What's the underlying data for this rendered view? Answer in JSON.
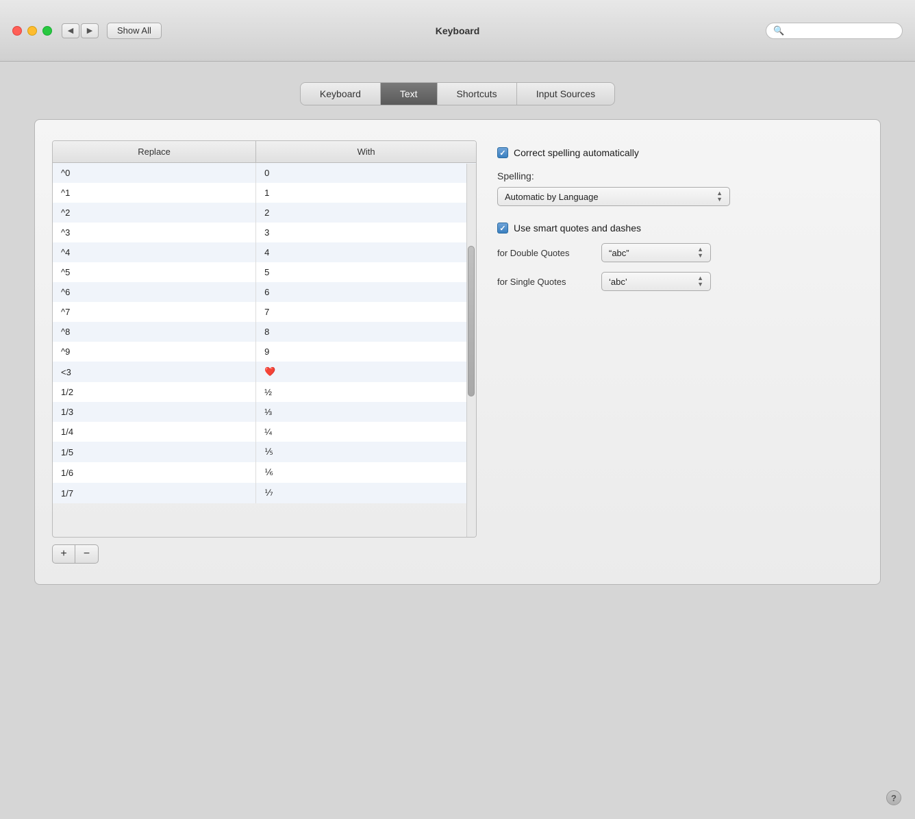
{
  "window": {
    "title": "Keyboard"
  },
  "titlebar": {
    "show_all_label": "Show All",
    "search_placeholder": ""
  },
  "tabs": [
    {
      "id": "keyboard",
      "label": "Keyboard",
      "active": false
    },
    {
      "id": "text",
      "label": "Text",
      "active": true
    },
    {
      "id": "shortcuts",
      "label": "Shortcuts",
      "active": false
    },
    {
      "id": "input-sources",
      "label": "Input Sources",
      "active": false
    }
  ],
  "table": {
    "col_replace": "Replace",
    "col_with": "With",
    "rows": [
      {
        "replace": "^0",
        "with": "0"
      },
      {
        "replace": "^1",
        "with": "1"
      },
      {
        "replace": "^2",
        "with": "2"
      },
      {
        "replace": "^3",
        "with": "3"
      },
      {
        "replace": "^4",
        "with": "4"
      },
      {
        "replace": "^5",
        "with": "5"
      },
      {
        "replace": "^6",
        "with": "6"
      },
      {
        "replace": "^7",
        "with": "7"
      },
      {
        "replace": "^8",
        "with": "8"
      },
      {
        "replace": "^9",
        "with": "9"
      },
      {
        "replace": "<3",
        "with": "❤️"
      },
      {
        "replace": "1/2",
        "with": "½"
      },
      {
        "replace": "1/3",
        "with": "⅓"
      },
      {
        "replace": "1/4",
        "with": "¼"
      },
      {
        "replace": "1/5",
        "with": "⅕"
      },
      {
        "replace": "1/6",
        "with": "⅙"
      },
      {
        "replace": "1/7",
        "with": "⅐"
      }
    ],
    "add_button": "+",
    "remove_button": "−"
  },
  "options": {
    "correct_spelling_label": "Correct spelling automatically",
    "correct_spelling_checked": true,
    "spelling_label": "Spelling:",
    "spelling_value": "Automatic by Language",
    "smart_quotes_label": "Use smart quotes and dashes",
    "smart_quotes_checked": true,
    "double_quotes_label": "for Double Quotes",
    "double_quotes_value": "“abc”",
    "single_quotes_label": "for Single Quotes",
    "single_quotes_value": "‘abc’"
  },
  "help": {
    "label": "?"
  },
  "icons": {
    "back": "◀",
    "forward": "▶",
    "search": "🔍",
    "arrow_up": "▲",
    "arrow_down": "▼"
  }
}
